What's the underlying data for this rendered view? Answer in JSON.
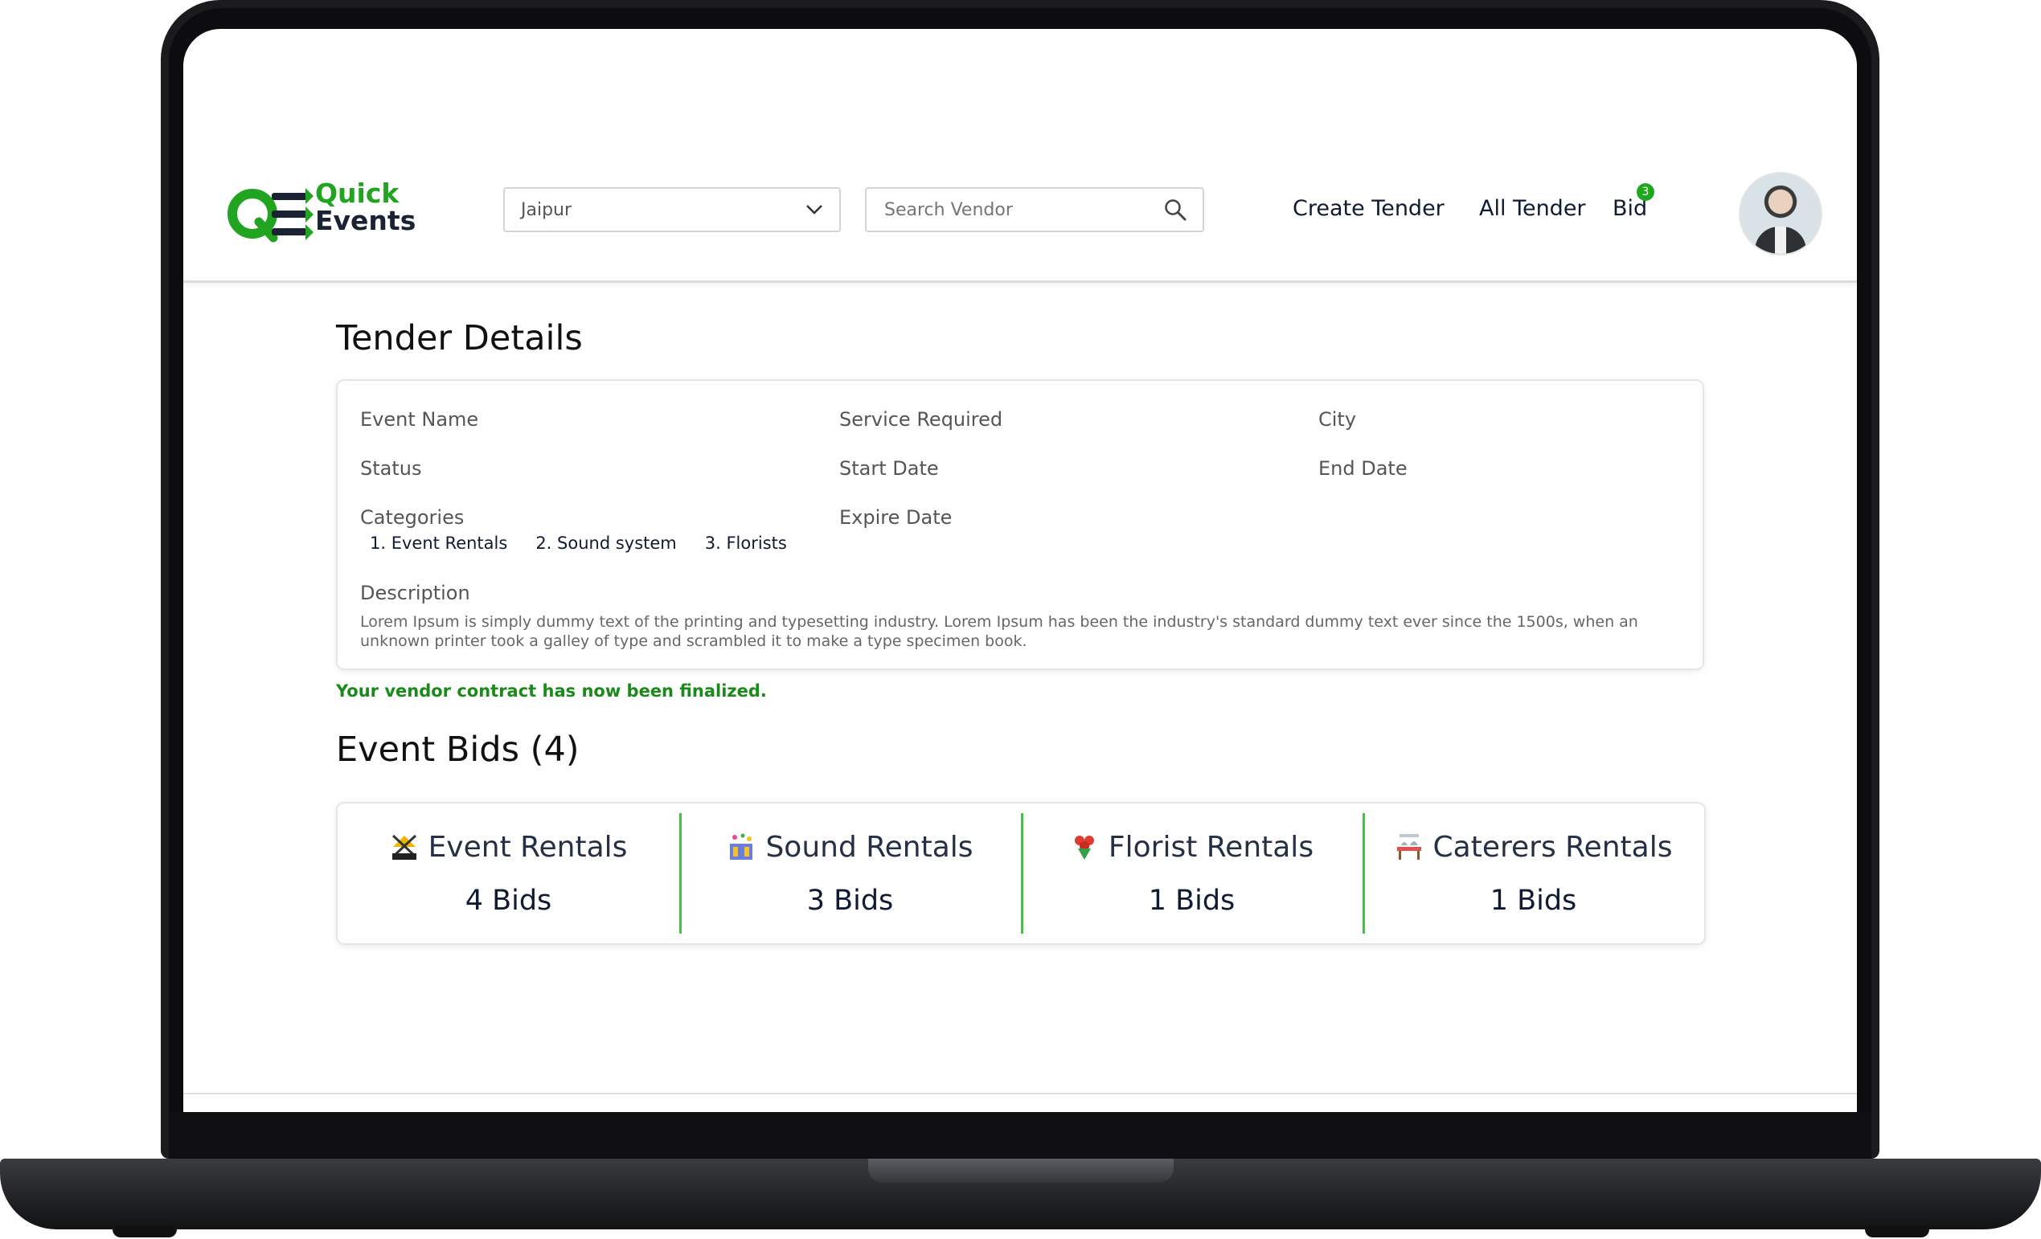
{
  "brand": {
    "line1": "Quick",
    "line2": "Events",
    "accent": "#21a521"
  },
  "header": {
    "city_select": {
      "value": "Jaipur"
    },
    "search": {
      "placeholder": "Search Vendor"
    },
    "nav": {
      "create_tender": "Create Tender",
      "all_tender": "All Tender",
      "bid": "Bid",
      "bid_badge": "3"
    }
  },
  "tender": {
    "title": "Tender Details",
    "labels": {
      "event_name": "Event Name",
      "service_required": "Service Required",
      "city": "City",
      "status": "Status",
      "start_date": "Start Date",
      "end_date": "End Date",
      "categories": "Categories",
      "expire_date": "Expire Date",
      "description": "Description"
    },
    "categories": [
      "1. Event Rentals",
      "2. Sound system",
      "3. Florists"
    ],
    "description": "Lorem Ipsum is simply dummy text of the printing and typesetting industry. Lorem Ipsum has been the industry's standard dummy text ever since the 1500s, when an unknown printer took a galley of type and scrambled it to make a type specimen book.",
    "finalized_message": "Your vendor contract has now been finalized."
  },
  "bids": {
    "title": "Event Bids (4)",
    "items": [
      {
        "label": "Event Rentals",
        "count": "4 Bids",
        "icon": "tent-icon"
      },
      {
        "label": "Sound Rentals",
        "count": "3 Bids",
        "icon": "speaker-icon"
      },
      {
        "label": "Florist Rentals",
        "count": "1 Bids",
        "icon": "flower-icon"
      },
      {
        "label": "Caterers Rentals",
        "count": "1 Bids",
        "icon": "catering-icon"
      }
    ]
  },
  "colors": {
    "success": "#1a8a1a",
    "divider": "#46c046",
    "text_dark": "#0f1a33"
  }
}
